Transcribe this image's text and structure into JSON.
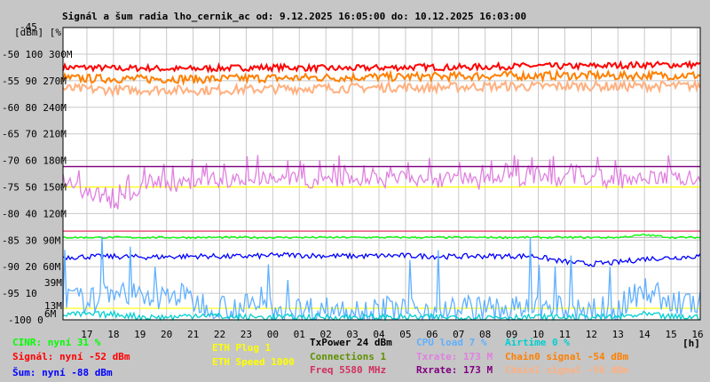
{
  "chart_data": {
    "type": "line",
    "title": "Signál a šum radia lho_cernik_ac od: 9.12.2025 16:05:00 do: 10.12.2025 16:03:00",
    "ylabel": "[dBm] [%]",
    "xlabel": "[h]",
    "grid": true,
    "legend": "bottom",
    "x_ticks": [
      "17",
      "18",
      "19",
      "20",
      "21",
      "22",
      "23",
      "00",
      "01",
      "02",
      "03",
      "04",
      "05",
      "06",
      "07",
      "08",
      "09",
      "10",
      "11",
      "12",
      "13",
      "14",
      "15",
      "16"
    ],
    "y_ticks_dbm": [
      "-45",
      "-50",
      "-55",
      "-60",
      "-65",
      "-70",
      "-75",
      "-80",
      "-85",
      "-90",
      "-95",
      "-100"
    ],
    "y_ticks_pct": [
      "100",
      "90",
      "80",
      "70",
      "60",
      "50",
      "40",
      "30",
      "20",
      "10",
      "0"
    ],
    "y_ticks_rate": [
      "300M",
      "270M",
      "240M",
      "210M",
      "180M",
      "150M",
      "120M",
      "90M",
      "60M"
    ],
    "extra_labels": [
      {
        "text": "39M",
        "color": "#e080e0"
      },
      {
        "text": "13M",
        "color": "#e080e0"
      },
      {
        "text": "6M",
        "color": "#800080"
      }
    ],
    "ylim_dbm": [
      -100,
      -45
    ],
    "series": [
      {
        "name": "Signál",
        "color": "#ff0000",
        "unit": "dBm",
        "values": [
          -52.5,
          -52.5,
          -52.7,
          -52.6,
          -52.8,
          -52.7,
          -52.6,
          -52.5,
          -52.5,
          -52.6,
          -52.7,
          -52.6,
          -52.5,
          -52.4,
          -52.5,
          -52.4,
          -52.3,
          -52.2,
          -52.3,
          -52.2,
          -52.1,
          -52.0,
          -52.0,
          -52.0
        ]
      },
      {
        "name": "Chain0 signal",
        "color": "#ff8000",
        "unit": "dBm",
        "values": [
          -54.5,
          -54.6,
          -54.6,
          -54.7,
          -54.6,
          -54.7,
          -54.6,
          -54.5,
          -54.5,
          -54.4,
          -54.4,
          -54.3,
          -54.3,
          -54.2,
          -54.2,
          -54.1,
          -54.0,
          -54.1,
          -54.0,
          -54.0,
          -54.1,
          -54.0,
          -54.0,
          -54.0
        ]
      },
      {
        "name": "Chain1 signal",
        "color": "#ffb080",
        "unit": "dBm",
        "values": [
          -56.5,
          -56.6,
          -56.8,
          -56.7,
          -56.7,
          -56.8,
          -56.7,
          -56.6,
          -56.5,
          -56.4,
          -56.4,
          -56.3,
          -56.2,
          -56.3,
          -56.2,
          -56.1,
          -56.0,
          -56.1,
          -56.0,
          -56.0,
          -56.1,
          -56.0,
          -56.0,
          -56.0
        ]
      },
      {
        "name": "Šum",
        "color": "#0000ff",
        "unit": "dBm",
        "values": [
          -88.2,
          -88.1,
          -88.1,
          -88.2,
          -88.1,
          -88.0,
          -88.1,
          -88.0,
          -87.8,
          -87.9,
          -88.0,
          -88.0,
          -87.9,
          -88.0,
          -88.1,
          -88.0,
          -88.0,
          -88.0,
          -89.0,
          -89.5,
          -89.2,
          -88.5,
          -88.3,
          -88.0
        ]
      },
      {
        "name": "CINR",
        "color": "#00ff00",
        "unit": "%",
        "values": [
          31,
          31,
          31,
          31,
          31,
          31,
          31,
          31,
          31,
          31,
          31,
          31,
          31,
          31,
          31,
          31,
          31,
          31,
          31,
          31,
          31,
          32,
          31,
          31
        ]
      },
      {
        "name": "Txrate",
        "color": "#e080e0",
        "unit": "M",
        "values": [
          165,
          150,
          140,
          165,
          160,
          168,
          165,
          170,
          168,
          165,
          168,
          166,
          168,
          166,
          168,
          165,
          168,
          170,
          168,
          168,
          166,
          168,
          170,
          170
        ]
      },
      {
        "name": "Rxrate",
        "color": "#800080",
        "unit": "M",
        "values": [
          173,
          173,
          173,
          173,
          173,
          173,
          173,
          173,
          173,
          173,
          173,
          173,
          173,
          173,
          173,
          173,
          173,
          173,
          173,
          173,
          173,
          173,
          173,
          173
        ]
      },
      {
        "name": "CPU load",
        "color": "#60b0ff",
        "unit": "%",
        "values": [
          8,
          7,
          12,
          7,
          10,
          6,
          5,
          5,
          4,
          4,
          4,
          4,
          4,
          4,
          4,
          4,
          4,
          4,
          4,
          4,
          4,
          12,
          6,
          6
        ]
      },
      {
        "name": "Airtime",
        "color": "#00d0d0",
        "unit": "%",
        "values": [
          2,
          2,
          2,
          1,
          1,
          2,
          1,
          1,
          1,
          1,
          1,
          1,
          1,
          1,
          1,
          1,
          1,
          1,
          1,
          1,
          1,
          2,
          1,
          1
        ]
      }
    ],
    "hlines": [
      {
        "name": "ETH Speed 1000",
        "color": "#ffff00",
        "pct": 50
      },
      {
        "name": "Freq",
        "color": "#e03060",
        "dbm": -83.3
      },
      {
        "name": "Rxrate",
        "color": "#800080",
        "rate": 173
      },
      {
        "name": "ETH Plug",
        "color": "#ffff00",
        "rate": 13
      }
    ]
  },
  "legend": {
    "cinr": "CINR: nyní 31 %",
    "signal": "Signál: nyní -52 dBm",
    "noise": "Šum: nyní -88 dBm",
    "eth_plug": "ETH Plug 1",
    "eth_speed": "ETH Speed 1000",
    "txpower": "TxPower 24 dBm",
    "connections": "Connections 1",
    "freq": "Freq 5580 MHz",
    "cpu": "CPU load 7 %",
    "txrate": "Txrate: 173 M",
    "rxrate": "Rxrate: 173 M",
    "airtime": "Airtime 0 %",
    "chain0": "Chain0 signal -54 dBm",
    "chain1": "Chain1 signal -56 dBm"
  }
}
